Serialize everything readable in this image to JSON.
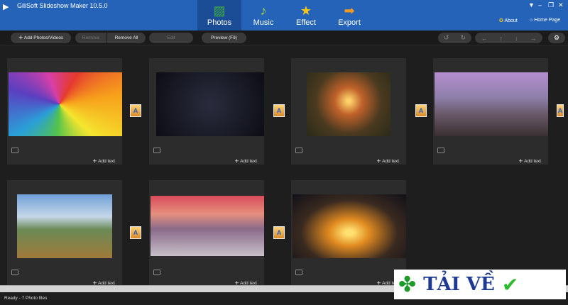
{
  "app": {
    "title": "GiliSoft Slideshow Maker 10.5.0"
  },
  "tabs": [
    {
      "label": "Photos",
      "icon": "photos-icon",
      "active": true
    },
    {
      "label": "Music",
      "icon": "music-note-icon"
    },
    {
      "label": "Effect",
      "icon": "magic-wand-icon"
    },
    {
      "label": "Export",
      "icon": "arrow-right-icon"
    }
  ],
  "links": {
    "about": "About",
    "home": "Home Page"
  },
  "toolbar": {
    "add": "Add Photos/Videos",
    "remove": "Remove",
    "remove_all": "Remove All",
    "edit": "Edit",
    "preview": "Preview (F9)"
  },
  "cards": [
    {
      "add_text": "Add text"
    },
    {
      "add_text": "Add text"
    },
    {
      "add_text": "Add text"
    },
    {
      "add_text": "Add text"
    },
    {
      "add_text": "Add text"
    },
    {
      "add_text": "Add text"
    },
    {
      "add_text": "Add text"
    }
  ],
  "status": "Ready - 7 Photo files",
  "watermark": "TẢI VỀ"
}
